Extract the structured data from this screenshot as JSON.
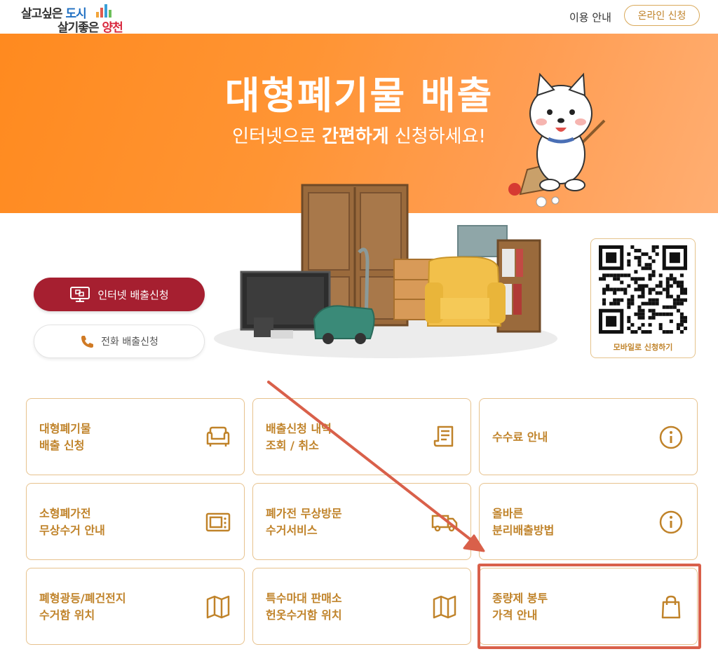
{
  "header": {
    "logo_line1_a": "살고싶은 ",
    "logo_line1_b": "도시",
    "logo_line2_a": "살기좋은 ",
    "logo_line2_b": "양천",
    "nav_guide": "이용 안내",
    "nav_apply": "온라인 신청"
  },
  "banner": {
    "title": "대형폐기물 배출",
    "subtitle_a": "인터넷으로 ",
    "subtitle_b": "간편하게",
    "subtitle_c": " 신청하세요!"
  },
  "actions": {
    "internet_label": "인터넷 배출신청",
    "phone_label": "전화 배출신청"
  },
  "qr": {
    "caption": "모바일로 신청하기"
  },
  "cards": [
    {
      "label": "대형폐기물\n배출 신청",
      "icon": "sofa-icon"
    },
    {
      "label": "배출신청 내역\n조회 / 취소",
      "icon": "receipt-icon"
    },
    {
      "label": "수수료 안내",
      "icon": "info-icon"
    },
    {
      "label": "소형폐가전\n무상수거 안내",
      "icon": "microwave-icon"
    },
    {
      "label": "폐가전 무상방문\n수거서비스",
      "icon": "truck-icon"
    },
    {
      "label": "올바른\n분리배출방법",
      "icon": "info-icon"
    },
    {
      "label": "폐형광등/폐건전지\n수거함 위치",
      "icon": "map-icon"
    },
    {
      "label": "특수마대 판매소\n헌옷수거함 위치",
      "icon": "map-icon"
    },
    {
      "label": "종량제 봉투\n가격 안내",
      "icon": "shopping-bag-icon"
    }
  ],
  "colors": {
    "accent": "#c0832a",
    "banner": "#ff8a1f",
    "primary_button": "#a61f30",
    "annotation": "#d9604a"
  }
}
